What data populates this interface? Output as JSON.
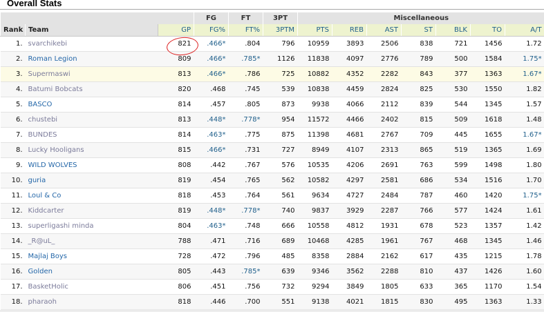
{
  "page": {
    "title": "Overall Stats"
  },
  "groups": {
    "fg": "FG",
    "ft": "FT",
    "threept": "3PT",
    "misc": "Miscellaneous"
  },
  "columns": {
    "rank": "Rank",
    "team": "Team",
    "gp": "GP",
    "fgp": "FG%",
    "ftp": "FT%",
    "tpm": "3PTM",
    "pts": "PTS",
    "reb": "REB",
    "ast": "AST",
    "st": "ST",
    "blk": "BLK",
    "to": "TO",
    "at": "A/T"
  },
  "rows": [
    {
      "rank": "1.",
      "team": "svarchikebi",
      "gp": "821",
      "fgp": ".466*",
      "ftp": ".804",
      "tpm": "796",
      "pts": "10959",
      "reb": "3893",
      "ast": "2506",
      "st": "838",
      "blk": "721",
      "to": "1456",
      "at": "1.72"
    },
    {
      "rank": "2.",
      "team": "Roman Legion",
      "gp": "809",
      "fgp": ".466*",
      "ftp": ".785*",
      "tpm": "1126",
      "pts": "11838",
      "reb": "4097",
      "ast": "2776",
      "st": "789",
      "blk": "500",
      "to": "1584",
      "at": "1.75*"
    },
    {
      "rank": "3.",
      "team": "Supermaswi",
      "gp": "813",
      "fgp": ".466*",
      "ftp": ".786",
      "tpm": "725",
      "pts": "10882",
      "reb": "4352",
      "ast": "2282",
      "st": "843",
      "blk": "377",
      "to": "1363",
      "at": "1.67*"
    },
    {
      "rank": "4.",
      "team": "Batumi Bobcats",
      "gp": "820",
      "fgp": ".468",
      "ftp": ".745",
      "tpm": "539",
      "pts": "10838",
      "reb": "4459",
      "ast": "2824",
      "st": "825",
      "blk": "530",
      "to": "1550",
      "at": "1.82"
    },
    {
      "rank": "5.",
      "team": "BASCO",
      "gp": "814",
      "fgp": ".457",
      "ftp": ".805",
      "tpm": "873",
      "pts": "9938",
      "reb": "4066",
      "ast": "2112",
      "st": "839",
      "blk": "544",
      "to": "1345",
      "at": "1.57"
    },
    {
      "rank": "6.",
      "team": "chustebi",
      "gp": "813",
      "fgp": ".448*",
      "ftp": ".778*",
      "tpm": "954",
      "pts": "11572",
      "reb": "4466",
      "ast": "2402",
      "st": "815",
      "blk": "509",
      "to": "1618",
      "at": "1.48"
    },
    {
      "rank": "7.",
      "team": "BUNDES",
      "gp": "814",
      "fgp": ".463*",
      "ftp": ".775",
      "tpm": "875",
      "pts": "11398",
      "reb": "4681",
      "ast": "2767",
      "st": "709",
      "blk": "445",
      "to": "1655",
      "at": "1.67*"
    },
    {
      "rank": "8.",
      "team": "Lucky Hooligans",
      "gp": "815",
      "fgp": ".466*",
      "ftp": ".731",
      "tpm": "727",
      "pts": "8949",
      "reb": "4107",
      "ast": "2313",
      "st": "865",
      "blk": "519",
      "to": "1365",
      "at": "1.69"
    },
    {
      "rank": "9.",
      "team": "WILD WOLVES",
      "gp": "808",
      "fgp": ".442",
      "ftp": ".767",
      "tpm": "576",
      "pts": "10535",
      "reb": "4206",
      "ast": "2691",
      "st": "763",
      "blk": "599",
      "to": "1498",
      "at": "1.80"
    },
    {
      "rank": "10.",
      "team": "guria",
      "gp": "819",
      "fgp": ".454",
      "ftp": ".765",
      "tpm": "562",
      "pts": "10582",
      "reb": "4297",
      "ast": "2581",
      "st": "686",
      "blk": "534",
      "to": "1516",
      "at": "1.70"
    },
    {
      "rank": "11.",
      "team": "Loul & Co",
      "gp": "818",
      "fgp": ".453",
      "ftp": ".764",
      "tpm": "561",
      "pts": "9634",
      "reb": "4727",
      "ast": "2484",
      "st": "787",
      "blk": "460",
      "to": "1420",
      "at": "1.75*"
    },
    {
      "rank": "12.",
      "team": "Kiddcarter",
      "gp": "819",
      "fgp": ".448*",
      "ftp": ".778*",
      "tpm": "740",
      "pts": "9837",
      "reb": "3929",
      "ast": "2287",
      "st": "766",
      "blk": "577",
      "to": "1424",
      "at": "1.61"
    },
    {
      "rank": "13.",
      "team": "superligashi minda",
      "gp": "804",
      "fgp": ".463*",
      "ftp": ".748",
      "tpm": "666",
      "pts": "10558",
      "reb": "4812",
      "ast": "1931",
      "st": "678",
      "blk": "523",
      "to": "1357",
      "at": "1.42"
    },
    {
      "rank": "14.",
      "team": "_R@uL_",
      "gp": "788",
      "fgp": ".471",
      "ftp": ".716",
      "tpm": "689",
      "pts": "10468",
      "reb": "4285",
      "ast": "1961",
      "st": "767",
      "blk": "468",
      "to": "1345",
      "at": "1.46"
    },
    {
      "rank": "15.",
      "team": "Majlaj Boys",
      "gp": "728",
      "fgp": ".472",
      "ftp": ".796",
      "tpm": "485",
      "pts": "8358",
      "reb": "2884",
      "ast": "2162",
      "st": "617",
      "blk": "435",
      "to": "1215",
      "at": "1.78"
    },
    {
      "rank": "16.",
      "team": "Golden",
      "gp": "805",
      "fgp": ".443",
      "ftp": ".785*",
      "tpm": "639",
      "pts": "9346",
      "reb": "3562",
      "ast": "2288",
      "st": "810",
      "blk": "437",
      "to": "1426",
      "at": "1.60"
    },
    {
      "rank": "17.",
      "team": "BasketHolic",
      "gp": "806",
      "fgp": ".451",
      "ftp": ".756",
      "tpm": "732",
      "pts": "9294",
      "reb": "3849",
      "ast": "1805",
      "st": "633",
      "blk": "365",
      "to": "1170",
      "at": "1.54"
    },
    {
      "rank": "18.",
      "team": "pharaoh",
      "gp": "818",
      "fgp": ".446",
      "ftp": ".700",
      "tpm": "551",
      "pts": "9138",
      "reb": "4021",
      "ast": "1815",
      "st": "830",
      "blk": "495",
      "to": "1363",
      "at": "1.33"
    }
  ],
  "visited_teams": [
    0,
    2,
    3,
    5,
    6,
    7,
    11,
    12,
    13,
    16,
    17
  ],
  "colors": {
    "link": "#2366a8",
    "visited": "#7b7b9a",
    "sort_header": "#eef3cf",
    "highlight_row": "#fdfbe5",
    "annotation": "#d22"
  }
}
